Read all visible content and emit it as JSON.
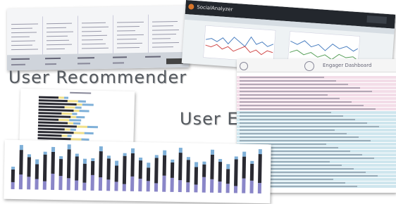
{
  "labels": {
    "recommender": "User Recommender",
    "engager": "User Engager"
  },
  "analyzer": {
    "title": "SocialAnalyzer"
  },
  "engager_dashboard": {
    "title": "Engager Dashboard"
  },
  "colors": {
    "headline": "#555a60",
    "bar_dark": "#2a2a32",
    "bar_blue": "#7fb0d8",
    "bar_purple": "#8a86c8",
    "bar_yellow": "#f0e08a",
    "row_blue": "#cfe6ee",
    "row_pink": "#f3dde8"
  }
}
